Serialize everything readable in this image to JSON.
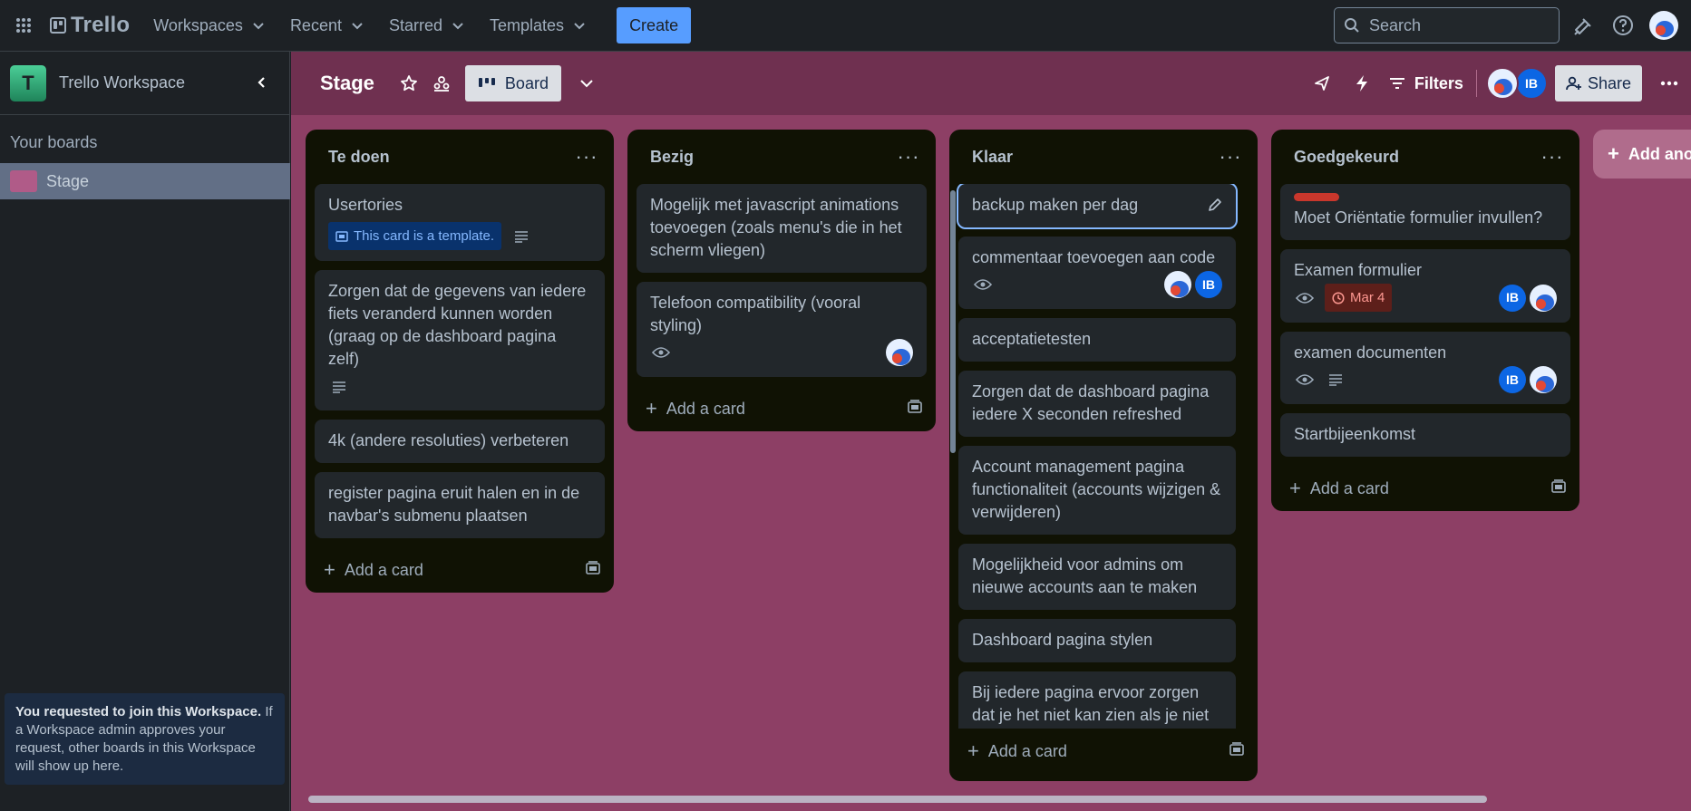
{
  "topbar": {
    "logo": "Trello",
    "nav": [
      "Workspaces",
      "Recent",
      "Starred",
      "Templates"
    ],
    "create_label": "Create",
    "search_placeholder": "Search"
  },
  "sidebar": {
    "workspace_initial": "T",
    "workspace_name": "Trello Workspace",
    "section_label": "Your boards",
    "boards": [
      {
        "label": "Stage",
        "color": "#b05b88"
      }
    ],
    "join_notice_bold": "You requested to join this Workspace.",
    "join_notice_text": " If a Workspace admin approves your request, other boards in this Workspace will show up here."
  },
  "board": {
    "title": "Stage",
    "view_label": "Board",
    "filters_label": "Filters",
    "share_label": "Share",
    "member_initials": "IB",
    "add_list_label": "Add another list",
    "background": "#8d3f65"
  },
  "lists": [
    {
      "title": "Te doen",
      "add_card": "Add a card",
      "cards": [
        {
          "text": "Usertories",
          "template_badge": "This card is a template.",
          "description_icon": true
        },
        {
          "text": "Zorgen dat de gegevens van iedere fiets veranderd kunnen worden (graag op de dashboard pagina zelf)",
          "description_icon": true
        },
        {
          "text": "4k (andere resoluties) verbeteren"
        },
        {
          "text": "register pagina eruit halen en in de navbar's submenu plaatsen"
        }
      ]
    },
    {
      "title": "Bezig",
      "add_card": "Add a card",
      "cards": [
        {
          "text": "Mogelijk met javascript animations toevoegen (zoals menu's die in het scherm vliegen)"
        },
        {
          "text": "Telefoon compatibility (vooral styling)",
          "watch_icon": true,
          "members": [
            "face"
          ]
        }
      ]
    },
    {
      "title": "Klaar",
      "add_card": "Add a card",
      "cards": [
        {
          "text": "backup maken per dag",
          "selected": true
        },
        {
          "text": "commentaar toevoegen aan code",
          "watch_icon": true,
          "members": [
            "face",
            "IB"
          ]
        },
        {
          "text": "acceptatietesten"
        },
        {
          "text": "Zorgen dat de dashboard pagina iedere X seconden refreshed"
        },
        {
          "text": "Account management pagina functionaliteit (accounts wijzigen & verwijderen)"
        },
        {
          "text": "Mogelijkheid voor admins om nieuwe accounts aan te maken"
        },
        {
          "text": "Dashboard pagina stylen"
        },
        {
          "text": "Bij iedere pagina ervoor zorgen dat je het niet kan zien als je niet ingelogt bent (behalve de login"
        }
      ]
    },
    {
      "title": "Goedgekeurd",
      "add_card": "Add a card",
      "cards": [
        {
          "text": "Moet Oriëntatie formulier invullen?",
          "label_color": "#c9372c"
        },
        {
          "text": "Examen formulier",
          "watch_icon": true,
          "due": "Mar 4",
          "members": [
            "IB",
            "face"
          ]
        },
        {
          "text": "examen documenten",
          "watch_icon": true,
          "description_icon": true,
          "members": [
            "IB",
            "face"
          ]
        },
        {
          "text": "Startbijeenkomst"
        }
      ]
    }
  ]
}
